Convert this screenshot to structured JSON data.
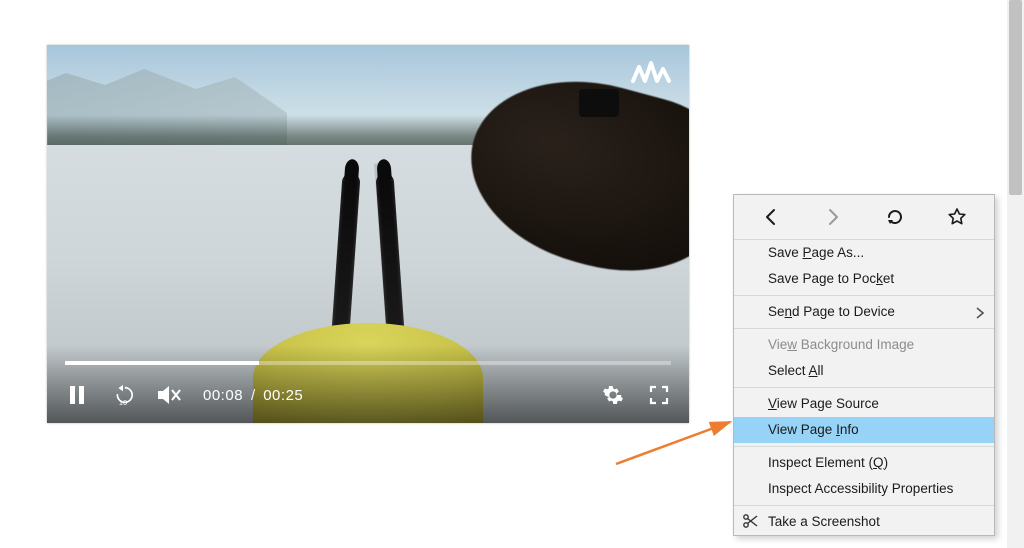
{
  "video": {
    "current_time": "00:08",
    "duration": "00:25",
    "progress_percent": 32,
    "watermark": "wave-logo",
    "buttons": {
      "pause": "Pause",
      "replay10": "Rewind 10 seconds",
      "mute": "Muted",
      "settings": "Settings",
      "fullscreen": "Full screen"
    }
  },
  "context_menu": {
    "nav": {
      "back": "Back",
      "forward": "Forward",
      "reload": "Reload",
      "bookmark": "Bookmark This Page"
    },
    "items": [
      {
        "key": "save_as",
        "html": "Save <u>P</u>age As...",
        "disabled": false,
        "submenu": false
      },
      {
        "key": "save_pocket",
        "html": "Save Page to Poc<u>k</u>et",
        "disabled": false,
        "submenu": false
      },
      {
        "sep": true
      },
      {
        "key": "send_to_device",
        "html": "Se<u>n</u>d Page to Device",
        "disabled": false,
        "submenu": true
      },
      {
        "sep": true
      },
      {
        "key": "view_bg_image",
        "html": "Vie<u>w</u> Background Image",
        "disabled": true,
        "submenu": false
      },
      {
        "key": "select_all",
        "html": "Select <u>A</u>ll",
        "disabled": false,
        "submenu": false
      },
      {
        "sep": true
      },
      {
        "key": "view_source",
        "html": "<u>V</u>iew Page Source",
        "disabled": false,
        "submenu": false
      },
      {
        "key": "view_info",
        "html": "View Page <u>I</u>nfo",
        "disabled": false,
        "submenu": false,
        "highlight": true
      },
      {
        "sep": true
      },
      {
        "key": "inspect_elem",
        "html": "Inspect Element (<u>Q</u>)",
        "disabled": false,
        "submenu": false
      },
      {
        "key": "inspect_a11y",
        "html": "Inspect Accessibility Properties",
        "disabled": false,
        "submenu": false
      },
      {
        "sep": true
      },
      {
        "key": "screenshot",
        "html": "Take a Screenshot",
        "disabled": false,
        "submenu": false,
        "icon": "scissors-icon"
      }
    ]
  }
}
